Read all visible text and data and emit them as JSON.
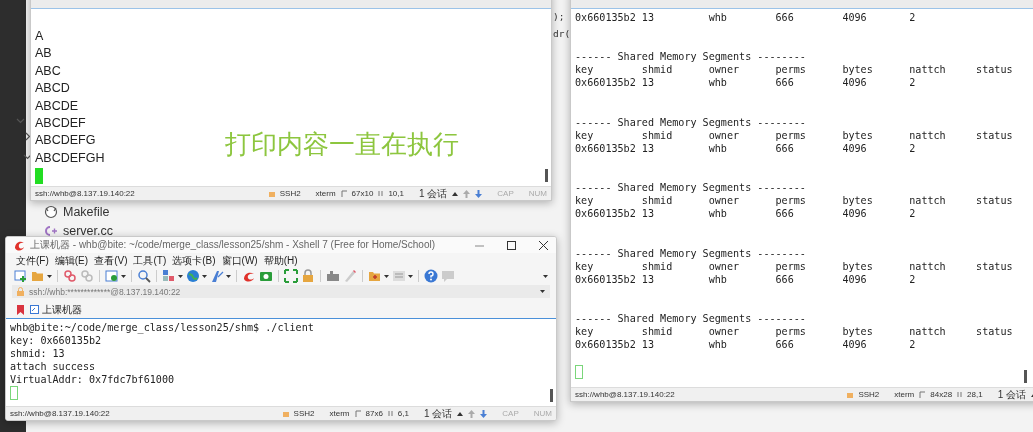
{
  "editor": {
    "tree_toggles": [
      {
        "expanded": true
      },
      {
        "expanded": false
      },
      {
        "expanded": true
      }
    ],
    "files": [
      {
        "name": "Makefile",
        "kind": "makefile"
      },
      {
        "name": "server.cc",
        "kind": "cpp"
      }
    ],
    "code_fragments": [
      ");",
      "dr("
    ]
  },
  "windows": [
    {
      "kind": "pane",
      "lines": [
        {
          "kind": "text",
          "text": "A"
        },
        {
          "kind": "text",
          "text": "AB"
        },
        {
          "kind": "text",
          "text": "ABC"
        },
        {
          "kind": "text",
          "text": "ABCD"
        },
        {
          "kind": "text",
          "text": "ABCDE"
        },
        {
          "kind": "text",
          "text": "ABCDEF"
        },
        {
          "kind": "text",
          "text": "ABCDEFG"
        },
        {
          "kind": "text",
          "text": "ABCDEFGH"
        }
      ],
      "cursor": {
        "filled": true
      },
      "caption": "打印内容一直在执行",
      "status_bar": [
        {
          "kind": "address",
          "text": "ssh://whb@8.137.19.140:22"
        },
        {
          "kind": "protocol",
          "text": "SSH2"
        },
        {
          "kind": "plain",
          "text": "xterm"
        },
        {
          "kind": "size",
          "text": "67x10"
        },
        {
          "kind": "position",
          "text": "10,1"
        },
        {
          "kind": "sessions",
          "text": "1 会话"
        },
        {
          "kind": "arrows"
        },
        {
          "kind": "plain",
          "text": "CAP",
          "disabled": true
        },
        {
          "kind": "plain",
          "text": "NUM",
          "disabled": true
        }
      ]
    },
    {
      "kind": "pane",
      "lines": [
        {
          "kind": "text",
          "text": "0x660135b2 13         whb        666        4096       2"
        },
        {
          "kind": "segment",
          "title": "------ Shared Memory Segments --------",
          "columns": "key        shmid      owner      perms      bytes      nattch     status",
          "row": "0x660135b2 13         whb        666        4096       2"
        },
        {
          "kind": "segment",
          "title": "------ Shared Memory Segments --------",
          "columns": "key        shmid      owner      perms      bytes      nattch     status",
          "row": "0x660135b2 13         whb        666        4096       2"
        },
        {
          "kind": "segment",
          "title": "------ Shared Memory Segments --------",
          "columns": "key        shmid      owner      perms      bytes      nattch     status",
          "row": "0x660135b2 13         whb        666        4096       2"
        },
        {
          "kind": "segment",
          "title": "------ Shared Memory Segments --------",
          "columns": "key        shmid      owner      perms      bytes      nattch     status",
          "row": "0x660135b2 13         whb        666        4096       2"
        },
        {
          "kind": "segment",
          "title": "------ Shared Memory Segments --------",
          "columns": "key        shmid      owner      perms      bytes      nattch     status",
          "row": "0x660135b2 13         whb        666        4096       2"
        },
        {
          "kind": "blank"
        }
      ],
      "cursor": {
        "filled": false
      },
      "status_bar": [
        {
          "kind": "address",
          "text": "ssh://whb@8.137.19.140:22"
        },
        {
          "kind": "protocol",
          "text": "SSH2"
        },
        {
          "kind": "plain",
          "text": "xterm"
        },
        {
          "kind": "size",
          "text": "84x28"
        },
        {
          "kind": "position",
          "text": "28,1"
        },
        {
          "kind": "sessions",
          "text": "1 会话"
        }
      ]
    },
    {
      "kind": "xshell",
      "title": "上课机器 - whb@bite: ~/code/merge_class/lesson25/shm - Xshell 7 (Free for Home/School)",
      "menu": [
        "文件(F)",
        "编辑(E)",
        "查看(V)",
        "工具(T)",
        "选项卡(B)",
        "窗口(W)",
        "帮助(H)"
      ],
      "address": "ssh://whb:*************@8.137.19.140:22",
      "tab": "上课机器",
      "lines": [
        {
          "kind": "text",
          "text": "whb@bite:~/code/merge_class/lesson25/shm$ ./client"
        },
        {
          "kind": "text",
          "text": "key: 0x660135b2"
        },
        {
          "kind": "text",
          "text": "shmid: 13"
        },
        {
          "kind": "text",
          "text": "attach success"
        },
        {
          "kind": "text",
          "text": "VirtualAddr: 0x7fdc7bf61000"
        }
      ],
      "cursor": {
        "filled": false
      },
      "status_bar": [
        {
          "kind": "address",
          "text": "ssh://whb@8.137.19.140:22"
        },
        {
          "kind": "protocol",
          "text": "SSH2"
        },
        {
          "kind": "plain",
          "text": "xterm"
        },
        {
          "kind": "size",
          "text": "87x6"
        },
        {
          "kind": "position",
          "text": "6,1"
        },
        {
          "kind": "sessions",
          "text": "1 会话"
        },
        {
          "kind": "arrows"
        },
        {
          "kind": "plain",
          "text": "CAP",
          "disabled": true
        },
        {
          "kind": "plain",
          "text": "NUM",
          "disabled": true
        }
      ]
    }
  ]
}
